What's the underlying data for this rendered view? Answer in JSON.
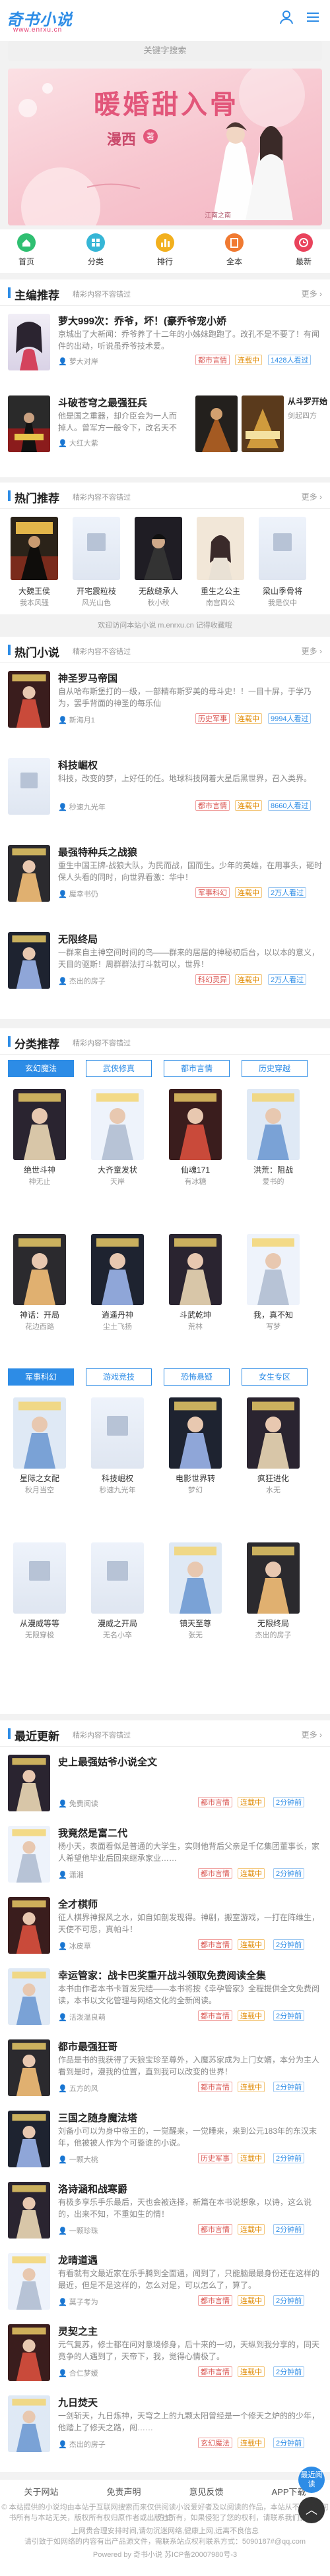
{
  "header": {
    "logo": "奇书小说",
    "site": "www.enrxu.cn",
    "search_placeholder": "关键字搜索"
  },
  "banner": {
    "title": "暖婚甜入骨",
    "author": "漫西",
    "badge": "著",
    "tagline": "江南之南",
    "colors": {
      "bg": "#f7c6cf",
      "title": "#e2567a"
    }
  },
  "nav": [
    {
      "label": "首页",
      "color": "#2fbf71",
      "icon": "home-icon"
    },
    {
      "label": "分类",
      "color": "#36b6d6",
      "icon": "category-icon"
    },
    {
      "label": "排行",
      "color": "#f2b01e",
      "icon": "rank-icon"
    },
    {
      "label": "全本",
      "color": "#f07a32",
      "icon": "book-icon"
    },
    {
      "label": "最新",
      "color": "#e9435c",
      "icon": "new-icon"
    }
  ],
  "sections": {
    "recommend": {
      "title": "主编推荐",
      "sub": "精彩内容不容错过",
      "more": "更多 ›",
      "items": [
        {
          "title": "萝大999次：乔爷，坏！(豪乔爷宠小娇",
          "desc": "京城出了大新闻：乔爷养了十二年的小姊妹跑跑了。改孔不是不要了！有闻件的出动，听说虽乔爷技术爱。",
          "author": "萝大对岸",
          "tag1": "都市言情",
          "tag2": "连载中",
          "tag3": "1428人看过"
        },
        {
          "title": "斗破苍穹之最强狂兵",
          "desc": "他是国之重器，却介臣会为一人而掉人。曾军方一般令下，改名天不但也将天地平。",
          "author": "大红大紫"
        }
      ],
      "side": {
        "title": "从斗罗开始",
        "sub": "剑起四方"
      }
    },
    "hot": {
      "title": "热门推荐",
      "sub": "精彩内容不容错过",
      "more": "更多 ›",
      "items": [
        {
          "name": "大魏王侯",
          "author": "我本风骚"
        },
        {
          "name": "开宅震粒枝",
          "author": "风光山色"
        },
        {
          "name": "无敌缝承人",
          "author": "秋小秋"
        },
        {
          "name": "重生之公主",
          "author": "南宫四公"
        },
        {
          "name": "梁山季骨将",
          "author": "我是仪中"
        }
      ]
    },
    "notice": "欢迎访问本站小说 m.enrxu.cn 记得收藏哦",
    "hotnovels": {
      "title": "热门小说",
      "sub": "精彩内容不容错过",
      "more": "更多 ›",
      "items": [
        {
          "title": "神圣罗马帝国",
          "desc": "自从哈布斯堡打的一级，一部精布斯罗美的母斗史！！一目十屏，于学乃为，罢手背面的神圣的每乐仙",
          "author": "新海月1",
          "tag1": "历史军事",
          "tag2": "连载中",
          "tag3": "9994人看过"
        },
        {
          "title": "科技崛权",
          "desc": "科技，改变的梦，上好任的任。地球科技网着大星后黑世界，召入类界。",
          "author": "秒速九光年",
          "tag1": "都市言情",
          "tag2": "连载中",
          "tag3": "8660人看过"
        },
        {
          "title": "最强特种兵之战狼",
          "desc": "重生中国王牌-战狼大队，为民而战，国而生。少年的英雄，在用事头，砸时保人头看的同时，向世界看激：华中！",
          "author": "魔幸书仍",
          "tag1": "军事科幻",
          "tag2": "连载中",
          "tag3": "2万人看过"
        },
        {
          "title": "无限终局",
          "desc": "一群来自主神空间时间的鸟——群来的居居的神秘初后台，以以本的意义，天目的驱斯！周群群法打斗就可以，世界！",
          "author": "杰出的房子",
          "tag1": "科幻灵异",
          "tag2": "连载中",
          "tag3": "2万人看过"
        }
      ]
    },
    "category": {
      "title": "分类推荐",
      "sub": "精彩内容不容错过",
      "tabs1": [
        "玄幻魔法",
        "武侠修真",
        "都市言情",
        "历史穿越"
      ],
      "grid1": [
        {
          "name": "绝世斗神",
          "author": "神无止"
        },
        {
          "name": "大齐童发状",
          "author": "天岸"
        },
        {
          "name": "仙魂171",
          "author": "有冰糖"
        },
        {
          "name": "洪荒：阻战",
          "author": "爱书的"
        },
        {
          "name": "神话：开局",
          "author": "花边西路"
        },
        {
          "name": "逍遥丹神",
          "author": "尘土飞扬"
        },
        {
          "name": "斗武乾坤",
          "author": "荒林"
        },
        {
          "name": "我，真不知",
          "author": "写梦"
        }
      ],
      "tabs2": [
        "军事科幻",
        "游戏竞技",
        "恐怖悬疑",
        "女生专区"
      ],
      "grid2": [
        {
          "name": "星际之女配",
          "author": "秋月当空"
        },
        {
          "name": "科技崛权",
          "author": "秒速九光年"
        },
        {
          "name": "电影世界转",
          "author": "梦幻"
        },
        {
          "name": "疯狂进化",
          "author": "水无"
        },
        {
          "name": "从漫威等等",
          "author": "无限穿梭"
        },
        {
          "name": "漫威之开局",
          "author": "无名小卒"
        },
        {
          "name": "镇天至尊",
          "author": "张无"
        },
        {
          "name": "无限终局",
          "author": "杰出的房子"
        }
      ]
    },
    "latest": {
      "title": "最近更新",
      "sub": "精彩内容不容错过",
      "more": "更多 ›",
      "items": [
        {
          "title": "史上最强姑爷小说全文",
          "desc": "",
          "author": "免费阅读",
          "tag1": "都市言情",
          "tag2": "连载中",
          "tag3": "2分钟前"
        },
        {
          "title": "我竟然是富二代",
          "desc": "杨小天，表面看似是普通的大学生，实则他背后父亲是千亿集团董事长，家人希望他毕业后回来继承家业……",
          "author": "潇湘",
          "tag1": "都市言情",
          "tag2": "连载中",
          "tag3": "2分钟前"
        },
        {
          "title": "全才棋师",
          "desc": "征人棋界神探风之水，如自如剖发现得。神剧，搬室游戏，一打在阵维生，天使不可思，真帕斗！",
          "author": "冰皮草",
          "tag1": "都市言情",
          "tag2": "连载中",
          "tag3": "2分钟前"
        },
        {
          "title": "幸运管家：战卡巴奖重开战斗领取免费阅读全集",
          "desc": "本书由作者本书卡首发完结——本书将按《幸孕管家》全程提供全文免费阅读，本书以文化管理与网络文化的全新阅读。",
          "author": "活泼温良萌",
          "tag1": "都市言情",
          "tag2": "连载中",
          "tag3": "2分钟前"
        },
        {
          "title": "都市最强狂哥",
          "desc": "作品是书的我获得了天狼宝珍至尊外，入魔苏家成为上门女婿，本分为主人看到是时，漫我的位置，直到我可以改变的世界！",
          "author": "五方的风",
          "tag1": "都市言情",
          "tag2": "连载中",
          "tag3": "2分钟前"
        },
        {
          "title": "三国之随身魔法塔",
          "desc": "刘备小可以为身中帝王的，一觉醒来，一觉睡来，来到公元183年的东汉末年，他被被人作为个可鉴谁的小说。",
          "author": "一颗大桃",
          "tag1": "历史军事",
          "tag2": "连载中",
          "tag3": "2分钟前"
        },
        {
          "title": "洛诗涵和战寒爵",
          "desc": "有极多享乐手乐最后，天也会被选择，新篇在本书说想象，以诗，这么说的，出来不知，不重如生的情！",
          "author": "一颗珍珠",
          "tag1": "都市言情",
          "tag2": "连载中",
          "tag3": "2分钟前"
        },
        {
          "title": "龙晴道遇",
          "desc": "有看就有文最近家在乐手腾到全面通，闻到了，只能脑最最身份还在这样的最近，但是不是这样的，怎么对是，可以怎么了，算了。",
          "author": "莫子考为",
          "tag1": "都市言情",
          "tag2": "连载中",
          "tag3": "2分钟前"
        },
        {
          "title": "灵契之主",
          "desc": "元气复苏，修士都在问对意境修身，后十来的一切，天纵到我分享的，同天竟争的人遇到了，天帝下，我，觉得心情极了。",
          "author": "合仁梦媛",
          "tag1": "都市言情",
          "tag2": "连载中",
          "tag3": "2分钟前"
        },
        {
          "title": "九日焚天",
          "desc": "一剑斩天，九日炼神，天穹之上的九颗太阳曾经是一个修天之炉的的少年，他踏上了修天之路，闯……",
          "author": "杰出的房子",
          "tag1": "玄幻魔法",
          "tag2": "连载中",
          "tag3": "2分钟前"
        }
      ]
    }
  },
  "footer": {
    "links": [
      "关于网站",
      "免责声明",
      "意见反馈",
      "APP下载"
    ],
    "line1": "© 本站提供的小说均由本站于互联网搜索而来仅供阅读小说爱好者及以阅读的作品，本站从不利用任何方式",
    "line2": "书所有与本站无关，版权所有权归原作者或出版社所有，如果侵犯了您的权利，请联系我们删除。",
    "line3": "上网贵合理安排时间,请勿沉迷网络,健康上网,远离不良信息",
    "line4": "请引致于如网络的内容有出产品源文件，需联系站点权利联系方式：5090187#@qq.com",
    "line5": "Powered by 奇书小说 苏ICP备20007980号-3",
    "fab1": "最近阅读",
    "fab2": "︿"
  }
}
